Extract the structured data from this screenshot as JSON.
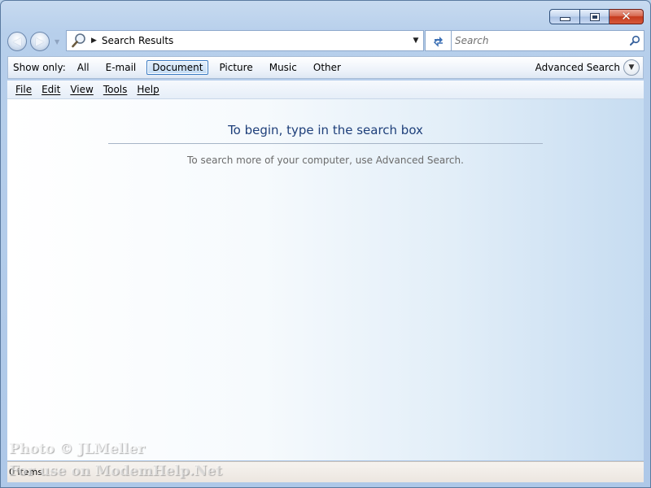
{
  "window": {
    "caption_buttons": {
      "minimize": "minimize-icon",
      "maximize": "maximize-icon",
      "close": "close-icon"
    }
  },
  "nav": {
    "address": "Search Results",
    "search_placeholder": "Search"
  },
  "show_only": {
    "label": "Show only:",
    "filters": [
      "All",
      "E-mail",
      "Document",
      "Picture",
      "Music",
      "Other"
    ],
    "selected": "Document",
    "advanced_search": "Advanced Search"
  },
  "menu": {
    "items": [
      "File",
      "Edit",
      "View",
      "Tools",
      "Help"
    ]
  },
  "content": {
    "title": "To begin, type in the search box",
    "hint": "To search more of your computer, use Advanced Search."
  },
  "status": {
    "items_count": "0 items"
  },
  "watermark": {
    "line1": "Photo © JLMeller",
    "line2": "For use on ModemHelp.Net"
  },
  "colors": {
    "accent": "#1e3f7a",
    "selected_border": "#3a7bc3",
    "close_button": "#c5391c"
  }
}
